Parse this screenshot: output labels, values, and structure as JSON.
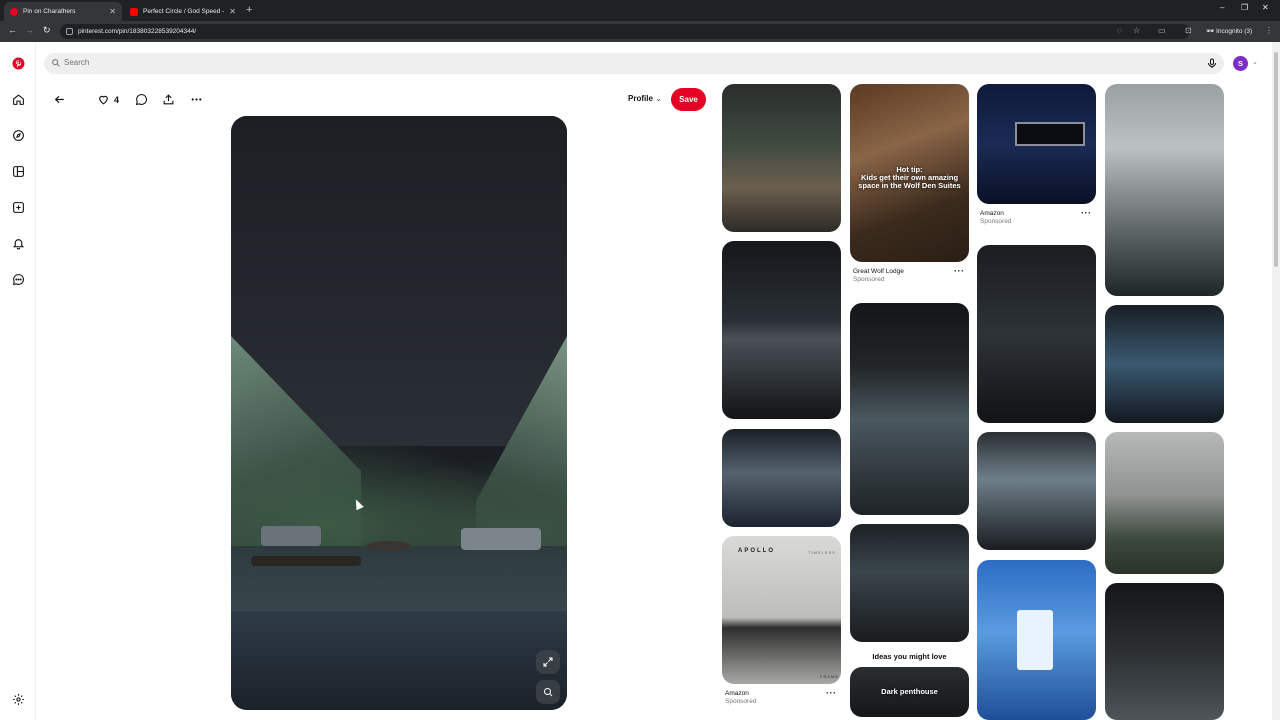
{
  "browser": {
    "tabs": [
      {
        "title": "Pin on Charathers",
        "active": true,
        "favicon_color": "#e60023"
      },
      {
        "title": "Perfect Circle / God Speed - Yo",
        "active": false,
        "favicon_color": "#ff0000"
      }
    ],
    "url": "pinterest.com/pin/183803228539204344/",
    "incognito_label": "Incognito (3)"
  },
  "search": {
    "placeholder": "Search"
  },
  "user": {
    "avatar_initial": "S"
  },
  "pin_actions": {
    "like_count": "4",
    "profile_label": "Profile",
    "save_label": "Save"
  },
  "masonry": {
    "great_wolf": {
      "overlay": "Hot tip:\nKids get their own amazing space in the Wolf Den Suites",
      "advertiser": "Great Wolf Lodge",
      "sponsored": "Sponsored"
    },
    "amazon_top": {
      "advertiser": "Amazon",
      "sponsored": "Sponsored"
    },
    "amazon_bottom": {
      "advertiser": "Amazon",
      "sponsored": "Sponsored",
      "brand_text": "APOLLO",
      "brand_sub": "TIMELESS",
      "corner_text": "FRAME"
    },
    "ideas_heading": "Ideas you might love",
    "dark_penthouse": "Dark penthouse"
  },
  "colors": {
    "accent": "#e60023",
    "avatar": "#7b2dc5"
  }
}
